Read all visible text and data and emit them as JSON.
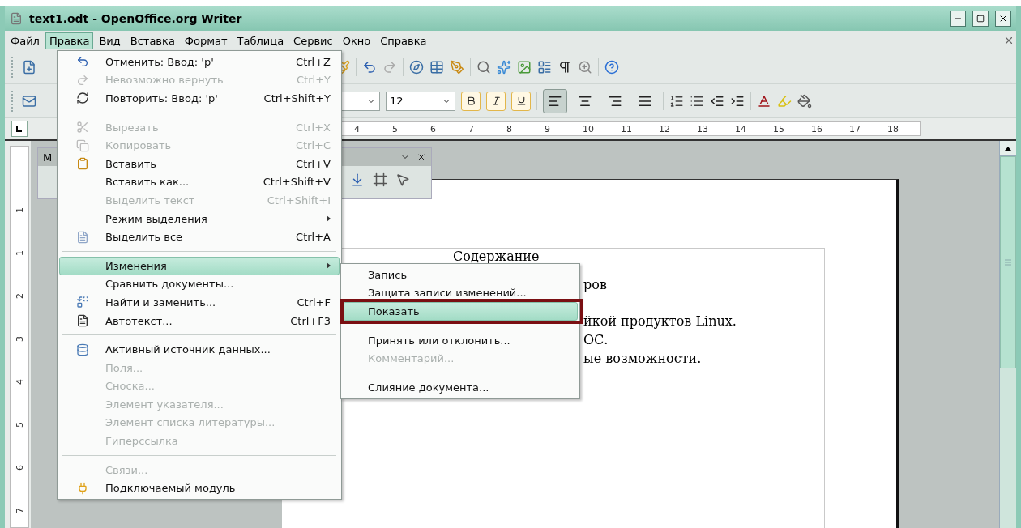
{
  "window": {
    "title": "text1.odt - OpenOffice.org Writer"
  },
  "menu_bar": [
    {
      "label": "Файл",
      "selected": false
    },
    {
      "label": "Правка",
      "selected": true
    },
    {
      "label": "Вид",
      "selected": false
    },
    {
      "label": "Вставка",
      "selected": false
    },
    {
      "label": "Формат",
      "selected": false
    },
    {
      "label": "Таблица",
      "selected": false
    },
    {
      "label": "Сервис",
      "selected": false
    },
    {
      "label": "Окно",
      "selected": false
    },
    {
      "label": "Справка",
      "selected": false
    }
  ],
  "format_toolbar": {
    "font_size": "12",
    "align": [
      {
        "selected": true
      },
      {
        "selected": false
      },
      {
        "selected": false
      },
      {
        "selected": false
      }
    ]
  },
  "ruler": {
    "marks": [
      "4",
      "5",
      "6",
      "7",
      "8",
      "9",
      "10",
      "11",
      "12",
      "13",
      "14",
      "15",
      "16",
      "17",
      "18"
    ]
  },
  "vertical_ruler": {
    "marks": [
      "1",
      "1",
      "2",
      "3",
      "4",
      "5",
      "6",
      "7"
    ]
  },
  "floating_toolbar": {
    "title": "M"
  },
  "document": {
    "lines": [
      {
        "kind": "heading",
        "text": "Содержание"
      },
      {
        "kind": "body",
        "text": "ров",
        "space_before": false
      },
      {
        "kind": "body",
        "text": "йкой продуктов Linux.",
        "space_before": true
      },
      {
        "kind": "body",
        "text": "ОС.",
        "space_before": false
      },
      {
        "kind": "body",
        "text": "ые возможности.",
        "space_before": false
      }
    ]
  },
  "edit_menu": {
    "items": [
      {
        "kind": "item",
        "label": "Отменить: Ввод: 'р'",
        "shortcut": "Ctrl+Z",
        "disabled": false,
        "selected": false,
        "submenu": false
      },
      {
        "kind": "item",
        "label": "Невозможно вернуть",
        "shortcut": "Ctrl+Y",
        "disabled": true,
        "selected": false,
        "submenu": false
      },
      {
        "kind": "item",
        "label": "Повторить: Ввод: 'р'",
        "shortcut": "Ctrl+Shift+Y",
        "disabled": false,
        "selected": false,
        "submenu": false
      },
      {
        "kind": "separator"
      },
      {
        "kind": "item",
        "label": "Вырезать",
        "shortcut": "Ctrl+X",
        "disabled": true,
        "selected": false,
        "submenu": false
      },
      {
        "kind": "item",
        "label": "Копировать",
        "shortcut": "Ctrl+C",
        "disabled": true,
        "selected": false,
        "submenu": false
      },
      {
        "kind": "item",
        "label": "Вставить",
        "shortcut": "Ctrl+V",
        "disabled": false,
        "selected": false,
        "submenu": false
      },
      {
        "kind": "item",
        "label": "Вставить как...",
        "shortcut": "Ctrl+Shift+V",
        "disabled": false,
        "selected": false,
        "submenu": false
      },
      {
        "kind": "item",
        "label": "Выделить текст",
        "shortcut": "Ctrl+Shift+I",
        "disabled": true,
        "selected": false,
        "submenu": false
      },
      {
        "kind": "item",
        "label": "Режим выделения",
        "disabled": false,
        "selected": false,
        "submenu": true
      },
      {
        "kind": "item",
        "label": "Выделить все",
        "shortcut": "Ctrl+A",
        "disabled": false,
        "selected": false,
        "submenu": false
      },
      {
        "kind": "separator"
      },
      {
        "kind": "item",
        "label": "Изменения",
        "disabled": false,
        "selected": true,
        "submenu": true
      },
      {
        "kind": "item",
        "label": "Сравнить документы...",
        "disabled": false,
        "selected": false,
        "submenu": false
      },
      {
        "kind": "item",
        "label": "Найти и заменить...",
        "shortcut": "Ctrl+F",
        "disabled": false,
        "selected": false,
        "submenu": false
      },
      {
        "kind": "item",
        "label": "Автотекст...",
        "shortcut": "Ctrl+F3",
        "disabled": false,
        "selected": false,
        "submenu": false
      },
      {
        "kind": "separator"
      },
      {
        "kind": "item",
        "label": "Активный источник данных...",
        "disabled": false,
        "selected": false,
        "submenu": false
      },
      {
        "kind": "item",
        "label": "Поля...",
        "disabled": true,
        "selected": false,
        "submenu": false
      },
      {
        "kind": "item",
        "label": "Сноска...",
        "disabled": true,
        "selected": false,
        "submenu": false
      },
      {
        "kind": "item",
        "label": "Элемент указателя...",
        "disabled": true,
        "selected": false,
        "submenu": false
      },
      {
        "kind": "item",
        "label": "Элемент списка литературы...",
        "disabled": true,
        "selected": false,
        "submenu": false
      },
      {
        "kind": "item",
        "label": "Гиперссылка",
        "disabled": true,
        "selected": false,
        "submenu": false
      },
      {
        "kind": "separator"
      },
      {
        "kind": "item",
        "label": "Связи...",
        "disabled": true,
        "selected": false,
        "submenu": false
      },
      {
        "kind": "item",
        "label": "Подключаемый модуль",
        "disabled": false,
        "selected": false,
        "submenu": false
      }
    ]
  },
  "changes_submenu": {
    "items": [
      {
        "kind": "item",
        "label": "Запись",
        "disabled": false,
        "selected": false,
        "highlighted": false
      },
      {
        "kind": "item",
        "label": "Защита записи изменений...",
        "disabled": false,
        "selected": false,
        "highlighted": false
      },
      {
        "kind": "item",
        "label": "Показать",
        "disabled": false,
        "selected": true,
        "highlighted": true
      },
      {
        "kind": "separator"
      },
      {
        "kind": "item",
        "label": "Принять или отклонить...",
        "disabled": false,
        "selected": false,
        "highlighted": false
      },
      {
        "kind": "item",
        "label": "Комментарий...",
        "disabled": true,
        "selected": false,
        "highlighted": false
      },
      {
        "kind": "separator"
      },
      {
        "kind": "item",
        "label": "Слияние документа...",
        "disabled": false,
        "selected": false,
        "highlighted": false
      }
    ]
  }
}
